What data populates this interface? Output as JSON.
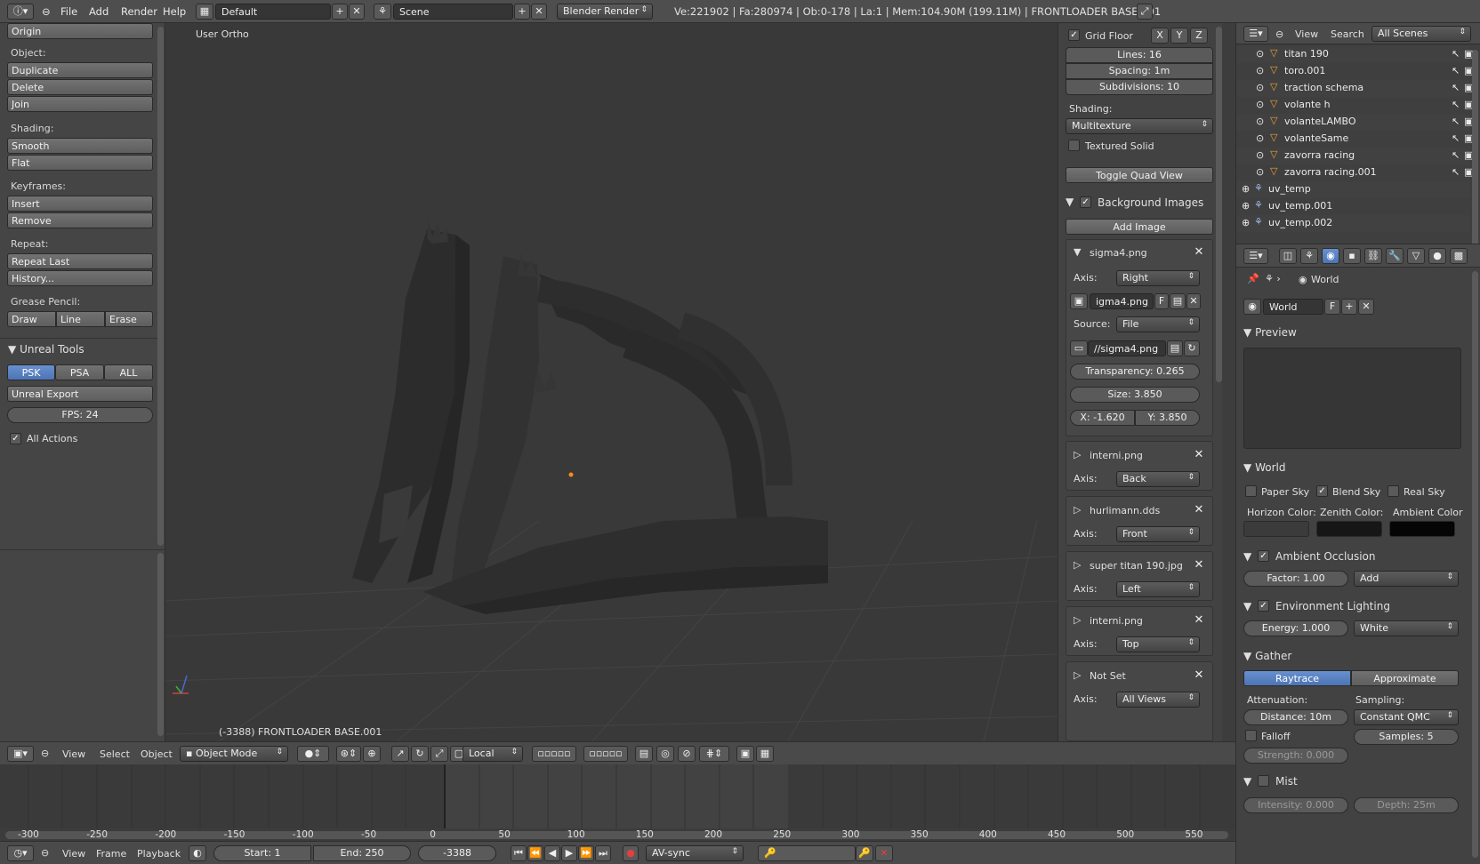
{
  "topbar": {
    "menus": [
      "File",
      "Add",
      "Render",
      "Help"
    ],
    "layout": "Default",
    "scene": "Scene",
    "engine": "Blender Render",
    "stats": "Ve:221902 | Fa:280974 | Ob:0-178 | La:1 | Mem:104.90M (199.11M) | FRONTLOADER BASE.001"
  },
  "toolshelf": {
    "origin": "Origin",
    "object_label": "Object:",
    "duplicate": "Duplicate",
    "delete": "Delete",
    "join": "Join",
    "shading_label": "Shading:",
    "smooth": "Smooth",
    "flat": "Flat",
    "keyframes_label": "Keyframes:",
    "insert": "Insert",
    "remove": "Remove",
    "repeat_label": "Repeat:",
    "repeat_last": "Repeat Last",
    "history": "History...",
    "grease_label": "Grease Pencil:",
    "draw": "Draw",
    "line": "Line",
    "erase": "Erase",
    "unreal_title": "Unreal Tools",
    "psk": "PSK",
    "psa": "PSA",
    "all": "ALL",
    "unreal_export": "Unreal Export",
    "fps": "FPS: 24",
    "all_actions": "All Actions"
  },
  "viewport": {
    "view_name": "User Ortho",
    "object_info": "(-3388) FRONTLOADER BASE.001"
  },
  "npanel": {
    "grid_floor": "Grid Floor",
    "axes": [
      "X",
      "Y",
      "Z"
    ],
    "lines": "Lines: 16",
    "spacing": "Spacing: 1m",
    "subdivisions": "Subdivisions: 10",
    "shading_label": "Shading:",
    "shading_value": "Multitexture",
    "textured_solid": "Textured Solid",
    "toggle_quad": "Toggle Quad View",
    "bg_images": "Background Images",
    "add_image": "Add Image",
    "image1": {
      "name": "sigma4.png",
      "axis_label": "Axis:",
      "axis": "Right",
      "file": "igma4.png",
      "f": "F",
      "source_label": "Source:",
      "source": "File",
      "path": "//sigma4.png",
      "transparency": "Transparency: 0.265",
      "size": "Size: 3.850",
      "x": "X: -1.620",
      "y": "Y: 3.850"
    },
    "images": [
      {
        "name": "interni.png",
        "axis": "Back"
      },
      {
        "name": "hurlimann.dds",
        "axis": "Front"
      },
      {
        "name": "super titan 190.jpg",
        "axis": "Left"
      },
      {
        "name": "interni.png",
        "axis": "Top"
      },
      {
        "name": "Not Set",
        "axis": "All Views"
      }
    ],
    "axis_label": "Axis:"
  },
  "outliner": {
    "view": "View",
    "search": "Search",
    "scenes": "All Scenes",
    "rows": [
      "titan 190",
      "toro.001",
      "traction schema",
      "volante h",
      "volanteLAMBO",
      "volanteSame",
      "zavorra racing",
      "zavorra racing.001",
      "uv_temp",
      "uv_temp.001",
      "uv_temp.002"
    ]
  },
  "props": {
    "breadcrumb": "World",
    "world_name": "World",
    "f": "F",
    "preview": "Preview",
    "world_panel": "World",
    "paper_sky": "Paper Sky",
    "blend_sky": "Blend Sky",
    "real_sky": "Real Sky",
    "horizon": "Horizon Color:",
    "zenith": "Zenith Color:",
    "ambient": "Ambient Color",
    "horizon_color": "#3b3b3b",
    "zenith_color": "#161616",
    "ambient_color": "#050505",
    "ao": "Ambient Occlusion",
    "factor": "Factor: 1.00",
    "ao_mode": "Add",
    "env": "Environment Lighting",
    "energy": "Energy: 1.000",
    "env_mode": "White",
    "gather": "Gather",
    "raytrace": "Raytrace",
    "approximate": "Approximate",
    "attenuation": "Attenuation:",
    "sampling": "Sampling:",
    "distance": "Distance: 10m",
    "sampling_mode": "Constant QMC",
    "falloff": "Falloff",
    "samples": "Samples: 5",
    "strength": "Strength: 0.000",
    "mist": "Mist",
    "intensity": "Intensity: 0.000",
    "depth": "Depth: 25m"
  },
  "vphead": {
    "view": "View",
    "select": "Select",
    "object": "Object",
    "mode": "Object Mode",
    "orientation": "Local"
  },
  "timeline": {
    "ticks": [
      "-300",
      "-250",
      "-200",
      "-150",
      "-100",
      "-50",
      "0",
      "50",
      "100",
      "150",
      "200",
      "250",
      "300",
      "350",
      "400",
      "450",
      "500",
      "550"
    ],
    "view": "View",
    "frame": "Frame",
    "playback": "Playback",
    "start": "Start: 1",
    "end": "End: 250",
    "current": "-3388",
    "sync": "AV-sync"
  }
}
